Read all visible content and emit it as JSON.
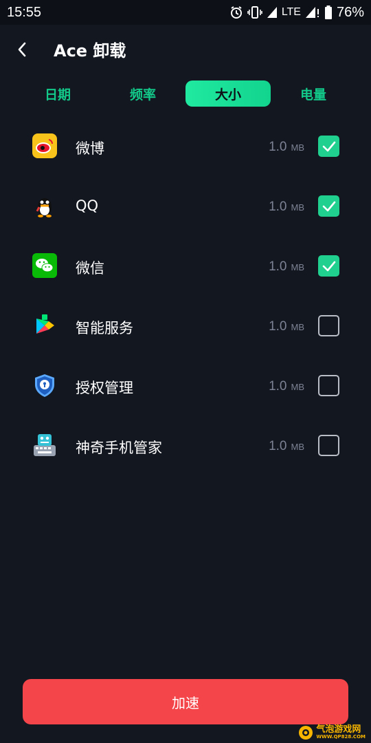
{
  "status_bar": {
    "time": "15:55",
    "network": "LTE",
    "battery": "76%"
  },
  "header": {
    "title": "Ace 卸载"
  },
  "tabs": [
    {
      "label": "日期",
      "active": false
    },
    {
      "label": "频率",
      "active": false
    },
    {
      "label": "大小",
      "active": true
    },
    {
      "label": "电量",
      "active": false
    }
  ],
  "apps": [
    {
      "name": "微博",
      "size": "1.0",
      "unit": "MB",
      "checked": true,
      "icon": "weibo-icon"
    },
    {
      "name": "QQ",
      "size": "1.0",
      "unit": "MB",
      "checked": true,
      "icon": "qq-icon"
    },
    {
      "name": "微信",
      "size": "1.0",
      "unit": "MB",
      "checked": true,
      "icon": "wechat-icon"
    },
    {
      "name": "智能服务",
      "size": "1.0",
      "unit": "MB",
      "checked": false,
      "icon": "smart-service-icon"
    },
    {
      "name": "授权管理",
      "size": "1.0",
      "unit": "MB",
      "checked": false,
      "icon": "authorization-icon"
    },
    {
      "name": "神奇手机管家",
      "size": "1.0",
      "unit": "MB",
      "checked": false,
      "icon": "phone-manager-icon"
    }
  ],
  "boost_button": {
    "label": "加速"
  },
  "watermark": {
    "text": "气泡游戏网",
    "sub": "WWW.QP828.COM"
  },
  "colors": {
    "background": "#131720",
    "accent_green": "#1fd08f",
    "button_red": "#f4454a",
    "muted_text": "#7d8394"
  }
}
